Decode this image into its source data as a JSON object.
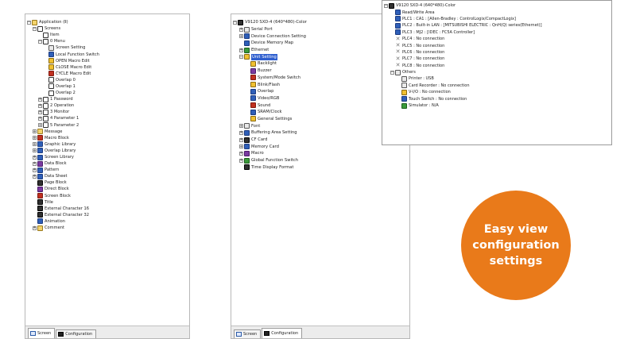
{
  "screen_panel": {
    "rows": [
      {
        "d": 0,
        "exp": "-",
        "icon": "folder",
        "label": "Application (Ⅱ)"
      },
      {
        "d": 1,
        "exp": "-",
        "icon": "screen",
        "label": "Screens"
      },
      {
        "d": 2,
        "exp": "",
        "icon": "screen",
        "label": "Item"
      },
      {
        "d": 2,
        "exp": "-",
        "icon": "screen",
        "label": "0 Menu"
      },
      {
        "d": 3,
        "exp": "",
        "icon": "doc",
        "label": "Screen Setting"
      },
      {
        "d": 3,
        "exp": "",
        "icon": "blue",
        "label": "Local Function Switch"
      },
      {
        "d": 3,
        "exp": "",
        "icon": "yellow",
        "label": "OPEN Macro Edit"
      },
      {
        "d": 3,
        "exp": "",
        "icon": "yellow",
        "label": "CLOSE Macro Edit"
      },
      {
        "d": 3,
        "exp": "",
        "icon": "red",
        "label": "CYCLE Macro Edit"
      },
      {
        "d": 3,
        "exp": "",
        "icon": "screen",
        "label": "Overlap 0"
      },
      {
        "d": 3,
        "exp": "",
        "icon": "screen",
        "label": "Overlap 1"
      },
      {
        "d": 3,
        "exp": "",
        "icon": "screen",
        "label": "Overlap 2"
      },
      {
        "d": 2,
        "exp": "+",
        "icon": "screen",
        "label": "1 Password"
      },
      {
        "d": 2,
        "exp": "+",
        "icon": "screen",
        "label": "2 Operation"
      },
      {
        "d": 2,
        "exp": "+",
        "icon": "screen",
        "label": "3 Monitor"
      },
      {
        "d": 2,
        "exp": "+",
        "icon": "screen",
        "label": "4 Parameter 1"
      },
      {
        "d": 2,
        "exp": "+",
        "icon": "screen",
        "label": "5 Parameter 2"
      },
      {
        "d": 1,
        "exp": "+",
        "icon": "folder",
        "label": "Message"
      },
      {
        "d": 1,
        "exp": "+",
        "icon": "red",
        "label": "Macro Block"
      },
      {
        "d": 1,
        "exp": "+",
        "icon": "blue",
        "label": "Graphic Library"
      },
      {
        "d": 1,
        "exp": "+",
        "icon": "blue",
        "label": "Overlap Library"
      },
      {
        "d": 1,
        "exp": "+",
        "icon": "blue",
        "label": "Screen Library"
      },
      {
        "d": 1,
        "exp": "+",
        "icon": "purple",
        "label": "Data Block"
      },
      {
        "d": 1,
        "exp": "+",
        "icon": "blue",
        "label": "Pattern"
      },
      {
        "d": 1,
        "exp": "+",
        "icon": "blue",
        "label": "Data Sheet"
      },
      {
        "d": 1,
        "exp": "",
        "icon": "dark",
        "label": "Page Block"
      },
      {
        "d": 1,
        "exp": "",
        "icon": "purple",
        "label": "Direct Block"
      },
      {
        "d": 1,
        "exp": "",
        "icon": "red",
        "label": "Screen Block"
      },
      {
        "d": 1,
        "exp": "",
        "icon": "dark",
        "label": "Title"
      },
      {
        "d": 1,
        "exp": "",
        "icon": "dark",
        "label": "External Character 16"
      },
      {
        "d": 1,
        "exp": "",
        "icon": "dark",
        "label": "External Character 32"
      },
      {
        "d": 1,
        "exp": "",
        "icon": "blue",
        "label": "Animation"
      },
      {
        "d": 1,
        "exp": "+",
        "icon": "folder",
        "label": "Comment"
      }
    ],
    "tabs": [
      "Screen",
      "Configuration"
    ]
  },
  "config_panel": {
    "rows": [
      {
        "d": 0,
        "exp": "-",
        "icon": "dark",
        "label": "V9120 SXD-4 (640*480)-Color",
        "hl": false
      },
      {
        "d": 1,
        "exp": "+",
        "icon": "doc",
        "label": "Serial Port",
        "hl": false
      },
      {
        "d": 1,
        "exp": "+",
        "icon": "blue",
        "label": "Device Connection Setting",
        "hl": false
      },
      {
        "d": 1,
        "exp": "",
        "icon": "blue",
        "label": "Device Memory Map",
        "hl": false
      },
      {
        "d": 1,
        "exp": "+",
        "icon": "green",
        "label": "Ethernet",
        "hl": false
      },
      {
        "d": 1,
        "exp": "-",
        "icon": "yellow",
        "label": "Unit Setting",
        "hl": true
      },
      {
        "d": 2,
        "exp": "",
        "icon": "yellow",
        "label": "Backlight",
        "hl": false
      },
      {
        "d": 2,
        "exp": "",
        "icon": "purple",
        "label": "Buzzer",
        "hl": false
      },
      {
        "d": 2,
        "exp": "",
        "icon": "red",
        "label": "System/Mode Switch",
        "hl": false
      },
      {
        "d": 2,
        "exp": "",
        "icon": "yellow",
        "label": "Blink/Flash",
        "hl": false
      },
      {
        "d": 2,
        "exp": "",
        "icon": "blue",
        "label": "Overlap",
        "hl": false
      },
      {
        "d": 2,
        "exp": "",
        "icon": "blue",
        "label": "Video/RGB",
        "hl": false
      },
      {
        "d": 2,
        "exp": "",
        "icon": "red",
        "label": "Sound",
        "hl": false
      },
      {
        "d": 2,
        "exp": "",
        "icon": "blue",
        "label": "SRAM/Clock",
        "hl": false
      },
      {
        "d": 2,
        "exp": "",
        "icon": "yellow",
        "label": "General Settings",
        "hl": false
      },
      {
        "d": 1,
        "exp": "+",
        "icon": "doc",
        "label": "Font",
        "hl": false
      },
      {
        "d": 1,
        "exp": "+",
        "icon": "blue",
        "label": "Buffering Area Setting",
        "hl": false
      },
      {
        "d": 1,
        "exp": "+",
        "icon": "dark",
        "label": "CF Card",
        "hl": false
      },
      {
        "d": 1,
        "exp": "+",
        "icon": "blue",
        "label": "Memory Card",
        "hl": false
      },
      {
        "d": 1,
        "exp": "+",
        "icon": "purple",
        "label": "Macro",
        "hl": false
      },
      {
        "d": 1,
        "exp": "+",
        "icon": "green",
        "label": "Global Function Switch",
        "hl": false
      },
      {
        "d": 1,
        "exp": "",
        "icon": "dark",
        "label": "Time Display Format",
        "hl": false
      }
    ],
    "tabs": [
      "Screen",
      "Configuration"
    ]
  },
  "units_panel": {
    "rows": [
      {
        "d": 0,
        "exp": "-",
        "icon": "dark",
        "label": "V9120 SXD-4 (640*480)-Color"
      },
      {
        "d": 1,
        "exp": "",
        "icon": "blue",
        "label": "Read/Write Area"
      },
      {
        "d": 1,
        "exp": "",
        "icon": "blue",
        "label": "PLC1 : CA1 : [Allen-Bradley : ControlLogix/CompactLogix]"
      },
      {
        "d": 1,
        "exp": "",
        "icon": "blue",
        "label": "PLC2 : Built-in LAN : [MITSUBISHI ELECTRIC : QnH(Q) series(Ethernet)]"
      },
      {
        "d": 1,
        "exp": "",
        "icon": "blue",
        "label": "PLC3 : MJ2 : [IDEC : FC5A Controller]"
      },
      {
        "d": 1,
        "exp": "",
        "icon": "cross",
        "label": "PLC4 : No connection"
      },
      {
        "d": 1,
        "exp": "",
        "icon": "cross",
        "label": "PLC5 : No connection"
      },
      {
        "d": 1,
        "exp": "",
        "icon": "cross",
        "label": "PLC6 : No connection"
      },
      {
        "d": 1,
        "exp": "",
        "icon": "cross",
        "label": "PLC7 : No connection"
      },
      {
        "d": 1,
        "exp": "",
        "icon": "cross",
        "label": "PLC8 : No connection"
      },
      {
        "d": 1,
        "exp": "-",
        "icon": "doc",
        "label": "Others"
      },
      {
        "d": 2,
        "exp": "",
        "icon": "doc",
        "label": "Printer : USB"
      },
      {
        "d": 2,
        "exp": "",
        "icon": "doc",
        "label": "Card Recorder : No connection"
      },
      {
        "d": 2,
        "exp": "",
        "icon": "yellow",
        "label": "V-I/O : No connection"
      },
      {
        "d": 2,
        "exp": "",
        "icon": "blue",
        "label": "Touch Switch : No connection"
      },
      {
        "d": 2,
        "exp": "",
        "icon": "green",
        "label": "Simulator : N/A"
      }
    ]
  },
  "callout": {
    "lines": [
      "Easy view",
      "configuration",
      "settings"
    ],
    "color": "#e97a1a"
  }
}
